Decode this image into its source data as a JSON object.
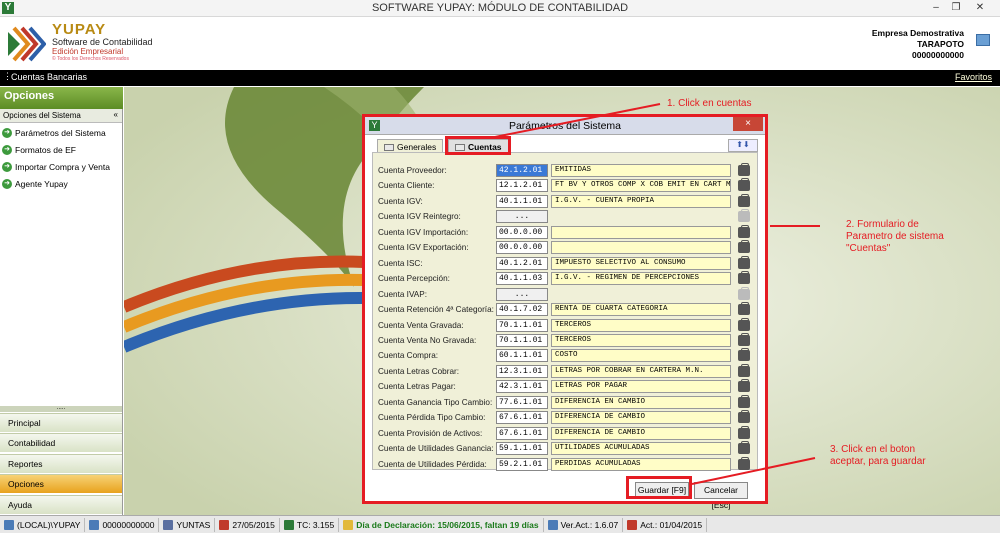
{
  "window": {
    "title": "SOFTWARE YUPAY: MÓDULO DE CONTABILIDAD",
    "app_icon": "Y"
  },
  "logo": {
    "name": "YUPAY",
    "subtitle": "Software de Contabilidad",
    "edition": "Edición Empresarial",
    "tagline": "© Todos los Derechos Reservados"
  },
  "company": {
    "name": "Empresa Demostrativa",
    "city": "TARAPOTO",
    "ruc": "00000000000"
  },
  "menubar": {
    "section": "Cuentas Bancarias",
    "favorites": "Favoritos"
  },
  "sidebar": {
    "header": "Opciones",
    "subheader": "Opciones del Sistema",
    "items": [
      {
        "label": "Parámetros del Sistema"
      },
      {
        "label": "Formatos de EF"
      },
      {
        "label": "Importar Compra y Venta"
      },
      {
        "label": "Agente Yupay"
      }
    ],
    "grip": "....."
  },
  "nav": [
    {
      "label": "Principal"
    },
    {
      "label": "Contabilidad"
    },
    {
      "label": "Reportes"
    },
    {
      "label": "Opciones"
    },
    {
      "label": "Ayuda"
    }
  ],
  "dialog": {
    "title": "Parámetros del Sistema",
    "close": "×",
    "tabs": [
      {
        "label": "Generales"
      },
      {
        "label": "Cuentas"
      }
    ],
    "nav_arrows": "⬆⬇",
    "rows": [
      {
        "label": "Cuenta Proveedor:",
        "code": "42.1.2.01",
        "desc": "EMITIDAS"
      },
      {
        "label": "Cuenta Cliente:",
        "code": "12.1.2.01",
        "desc": "FT BV Y OTROS COMP X COB EMIT EN CART M.N"
      },
      {
        "label": "Cuenta IGV:",
        "code": "40.1.1.01",
        "desc": "I.G.V. - CUENTA PROPIA"
      },
      {
        "label": "Cuenta IGV Reintegro:",
        "code": "...",
        "desc": ""
      },
      {
        "label": "Cuenta IGV Importación:",
        "code": "00.0.0.00",
        "desc": ""
      },
      {
        "label": "Cuenta IGV Exportación:",
        "code": "00.0.0.00",
        "desc": ""
      },
      {
        "label": "Cuenta ISC:",
        "code": "40.1.2.01",
        "desc": "IMPUESTO SELECTIVO AL CONSUMO"
      },
      {
        "label": "Cuenta Percepción:",
        "code": "40.1.1.03",
        "desc": "I.G.V. - REGIMEN DE PERCEPCIONES"
      },
      {
        "label": "Cuenta IVAP:",
        "code": "...",
        "desc": ""
      },
      {
        "label": "Cuenta Retención 4ª Categoría:",
        "code": "40.1.7.02",
        "desc": "RENTA DE CUARTA CATEGORIA"
      },
      {
        "label": "Cuenta Venta Gravada:",
        "code": "70.1.1.01",
        "desc": "TERCEROS"
      },
      {
        "label": "Cuenta Venta No Gravada:",
        "code": "70.1.1.01",
        "desc": "TERCEROS"
      },
      {
        "label": "Cuenta Compra:",
        "code": "60.1.1.01",
        "desc": "COSTO"
      },
      {
        "label": "Cuenta Letras Cobrar:",
        "code": "12.3.1.01",
        "desc": "LETRAS POR COBRAR EN CARTERA M.N."
      },
      {
        "label": "Cuenta Letras Pagar:",
        "code": "42.3.1.01",
        "desc": "LETRAS POR PAGAR"
      },
      {
        "label": "Cuenta Ganancia Tipo Cambio:",
        "code": "77.6.1.01",
        "desc": "DIFERENCIA EN CAMBIO"
      },
      {
        "label": "Cuenta Pérdida Tipo Cambio:",
        "code": "67.6.1.01",
        "desc": "DIFERENCIA DE CAMBIO"
      },
      {
        "label": "Cuenta Provisión de Activos:",
        "code": "67.6.1.01",
        "desc": "DIFERENCIA DE CAMBIO"
      },
      {
        "label": "Cuenta de Utilidades Ganancia:",
        "code": "59.1.1.01",
        "desc": "UTILIDADES ACUMULADAS"
      },
      {
        "label": "Cuenta de Utilidades Pérdida:",
        "code": "59.2.1.01",
        "desc": "PERDIDAS ACUMULADAS"
      }
    ],
    "save": "Guardar [F9]",
    "cancel": "Cancelar [Esc]"
  },
  "annotations": {
    "a1": "1. Click en cuentas",
    "a2": "2. Formulario de Parametro de sistema \"Cuentas\"",
    "a3": "3. Click en el boton aceptar, para guardar"
  },
  "status": [
    {
      "text": "(LOCAL)\\YUPAY"
    },
    {
      "text": "00000000000"
    },
    {
      "text": "YUNTAS"
    },
    {
      "text": "27/05/2015"
    },
    {
      "text": "TC: 3.155"
    },
    {
      "text": "Día de Declaración: 15/06/2015, faltan 19 días"
    },
    {
      "text": "Ver.Act.: 1.6.07"
    },
    {
      "text": "Act.: 01/04/2015"
    }
  ],
  "colors": {
    "accent_green": "#5c8c25",
    "annotation_red": "#e51c23",
    "field_yellow": "#fffdc7"
  }
}
